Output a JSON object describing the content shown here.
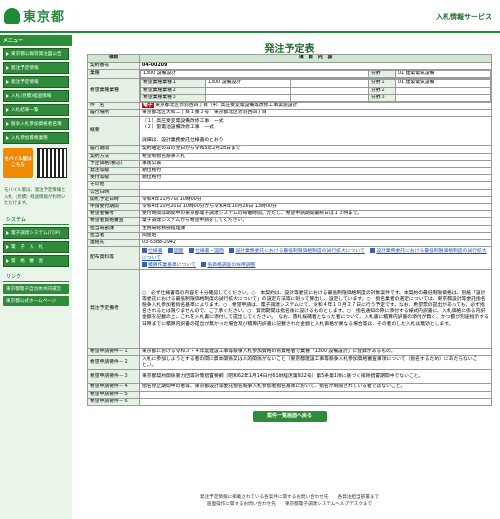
{
  "header": {
    "logo_text": "東京都",
    "site_title": "入札情報サービス"
  },
  "sidebar": {
    "menu_title": "メニュー",
    "items": [
      "東京都公報等発注図公告",
      "発注予定情報",
      "発注予定情報",
      "入札(見積)経過情報",
      "入札結果一覧",
      "競争入札参加資格者名簿",
      "入札参加資格業務"
    ],
    "mobile_label": "モバイル版はこちら",
    "mobile_note": "モバイル版は、発注予定情報と入札（見積）経過情報が利用いただけます。",
    "system_title": "システム",
    "system_items": [
      "電子調達システム(TOP)",
      "電　子　入　札",
      "資　格　審　査"
    ],
    "links_title": "リンク",
    "links": [
      "東京都電子自治体共同運営",
      "東京都公式ホームページ"
    ]
  },
  "page_title": "発注予定表",
  "table": {
    "col1": "項目",
    "col2": "項　目　内　容",
    "rows": {
      "contract_no_k": "契約番号",
      "contract_no_v": "04-00209",
      "business_k": "業種",
      "business_v": "1300 設備設計",
      "bunya": "分野",
      "bunya1": "分野１",
      "bunya1_v": "01 建築電気設備",
      "hope_k": "希望業種業種",
      "hope1": "希望業種業種１",
      "hope1_v": "1300 設備設計",
      "hope2": "希望業種業種２",
      "hope3": "希望業種業種３",
      "bunya2": "分野２",
      "bunya3": "分野３",
      "name_k": "件　名",
      "name_tag": "電子",
      "name_v": "東京都北区赤羽西四丁目（4）高圧受変電設備等改修工事実施設計",
      "place_k": "履行場所",
      "place_v": "東京都北区大和二丁目１番３号　東京都北区赤羽西四丁目",
      "summary_k": "概要",
      "summary_v1": "（１）高圧受変電設備改修工事　一式",
      "summary_v2": "（２）雷電池設備改修工事　一式",
      "summary_v3": "詳細は、設計業務委託仕様書のとおり",
      "period_k": "履行期間",
      "period_v": "契約確定の日の翌日から令和5年2月28日まで",
      "method_k": "契約方法",
      "method_v": "希望制指名競争入札",
      "price_k": "予定価格(税込)",
      "price_v": "事後公表",
      "section_k": "発注等級",
      "section_v": "順位格付",
      "accept_k": "受付等級",
      "accept_v": "順位格付",
      "other_k": "その他",
      "other_v": "",
      "date_k": "公告日時",
      "date_v": "",
      "open_k": "開札予定日時",
      "open_v": "令和4年11月7日 10時00分",
      "apply_k": "申請受付期間",
      "apply_v": "令和4年10月20日 10時00分から令和4年10月26日 13時00分",
      "note_k": "希望者備考",
      "note_v": "受付時間は期間中の東京都電子調達システムの稼働時間。ただし、希望申請期間最終日は１３時まで。",
      "exam_k": "希望者資格審査",
      "exam_v": "電子調達システムから希望申請をしてください。",
      "dept_k": "担当局部課",
      "dept_v": "主税局総務部経理課",
      "person_k": "担当者",
      "person_v": "岡屋昭",
      "tel_k": "連絡先",
      "tel_v": "03-5388-2942",
      "dist_k": "配布資料等",
      "dist_links": [
        "仕様書",
        "図面",
        "仕様書・図面",
        "設計業務委託における最低制限価格制度の試行拡大について",
        "設計業務委託における最低制限価格制度の試行拡大について",
        "設計業務委託における最低制限価格制度の設計",
        "積算作業基準について",
        "低価格調査の採用調整"
      ],
      "notes_k": "発注予定備考",
      "notes_v": "○　必ず仕様書等の内容を十分確認してください。○　本契約は、設計等委託における最低制限価格制度の対象案件です。本契約の最低制限価格は、別紙「設計等委託における最低制限価格制度の試行拡大について」の設定方法等に則って算出し、設定しています。○　指名業者の選定については、東京都設計等委託指名競争入札参加者指名基準によります。○　希望申請は、電子調達システムにて、令和４年１０月２７日に行う予定です。なお、希望票の提出があっても、必ず指名されるとは限りませんので、ご了承ください。○　質問期間は指名後に設けるものとします。○　指名通知の際に添付する様式内訳書に、入札価格に係る内訳金額を記載の上、これを入札書に添付して提出してください。　なお、落札候補者となった者について、入札書に積算内訳書の添付が無く、かつ都が別途指示する日時までに積算内訳書の提出が無かった場合及び積算内訳書に記載された金額と入札価格が異なる場合等は、その者のした入札は無効とします。",
      "h1_k": "希望申請要件－１",
      "h1_v": "東京都における令和３・４年度建設工事等競争入札参加資格の有資格者で業種「1300 設備設計」に登録があるもの。",
      "h2_k": "希望申請要件－２",
      "h2_v": "入札に参加しようとする者の間に資本関係又は人的関係がないこと（東京都建設工事等競争入札参加資格審査事項について（指名するため）にあたらないこと。）。",
      "h3_k": "希望申請要件－３",
      "h3_v": "東京都契約関係暴力団等対策措置要綱（昭和62年1月14日付61財経庶第922号）第5条第1項に基づく排除措置期間中でないこと。",
      "h4_k": "希望申請要件－４",
      "h4_v": "指名停止期間中の者等、東京都設計等委託指名競争入札参加者指名基準において、指名が制限されている者ではないこと。",
      "h5_k": "希望申請要件－５",
      "h5_v": "",
      "h6_k": "希望申請要件－６",
      "h6_v": ""
    }
  },
  "back_button": "案件一覧画面へ戻る",
  "footer": {
    "line1": "発注予定情報に掲載されている各案件に関するお問い合わせ先　　各発注担当部署まで",
    "line2": "画面操作に関するお問い合わせ先　　東京都電子調達システムヘルプデスクまで"
  },
  "colors": {
    "accent": "#2e8b3a",
    "header_green": "#1f8a3a",
    "mobile": "#f08a00"
  }
}
